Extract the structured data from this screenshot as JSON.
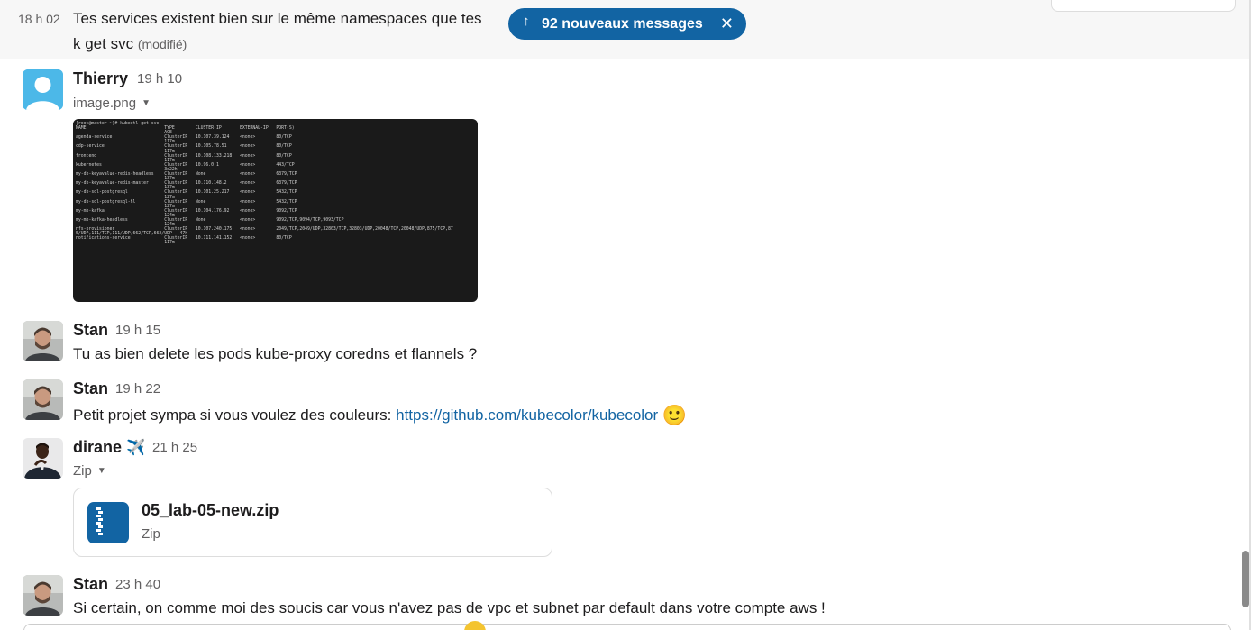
{
  "banner": {
    "arrow": "↑",
    "label": "92 nouveaux messages",
    "close": "✕"
  },
  "messages": [
    {
      "time": "18 h 02",
      "line1": "Tes services existent bien sur le même namespaces que tes",
      "line2": "k get svc",
      "edited": "(modifié)"
    },
    {
      "author": "Thierry",
      "time": "19 h 10",
      "file_label": "image.png",
      "terminal": "[root@master ~]# kubectl get svc\nNAME                              TYPE        CLUSTER-IP       EXTERNAL-IP   PORT(S)\n                                  AGE\nagenda-service                    ClusterIP   10.107.39.124    <none>        80/TCP\n                                  117m\ncdp-service                       ClusterIP   10.105.78.51     <none>        80/TCP\n                                  117m\nfrontend                          ClusterIP   10.108.133.218   <none>        80/TCP\n                                  117m\nkubernetes                        ClusterIP   10.96.0.1        <none>        443/TCP\n                                  3d22h\nmy-db-keyavalue-redis-headless    ClusterIP   None             <none>        6379/TCP\n                                  137m\nmy-db-keyavalue-redis-master      ClusterIP   10.110.148.2     <none>        6379/TCP\n                                  137m\nmy-db-sql-postgresql              ClusterIP   10.101.25.217    <none>        5432/TCP\n                                  127m\nmy-db-sql-postgresql-hl           ClusterIP   None             <none>        5432/TCP\n                                  127m\nmy-mb-kafka                       ClusterIP   10.104.176.92    <none>        9092/TCP\n                                  124m\nmy-mb-kafka-headless              ClusterIP   None             <none>        9092/TCP,9094/TCP,9093/TCP\n                                  124m\nnfs-provisioner                   ClusterIP   10.107.240.175   <none>        2049/TCP,2049/UDP,32803/TCP,32803/UDP,20048/TCP,20048/UDP,875/TCP,87\n5/UDP,111/TCP,111/UDP,662/TCP,662/UDP   47h\nnotifications-service             ClusterIP   10.111.141.152   <none>        80/TCP\n                                  117m"
    },
    {
      "author": "Stan",
      "time": "19 h 15",
      "text": "Tu as bien delete les pods kube-proxy coredns et flannels ?"
    },
    {
      "author": "Stan",
      "time": "19 h 22",
      "text": "Petit projet sympa si vous voulez des couleurs: ",
      "link": "https://github.com/kubecolor/kubecolor",
      "emoji": "🙂"
    },
    {
      "author": "dirane",
      "author_emoji": "✈️",
      "time": "21 h 25",
      "file_label": "Zip",
      "file_name": "05_lab-05-new.zip",
      "file_type": "Zip"
    },
    {
      "author": "Stan",
      "time": "23 h 40",
      "text": "Si certain, on comme moi des soucis car vous n'avez pas de vpc et subnet par default dans votre compte aws !"
    }
  ],
  "colors": {
    "link": "#1264a3",
    "banner": "#1264a3",
    "highlight": "#f7f7f7"
  }
}
